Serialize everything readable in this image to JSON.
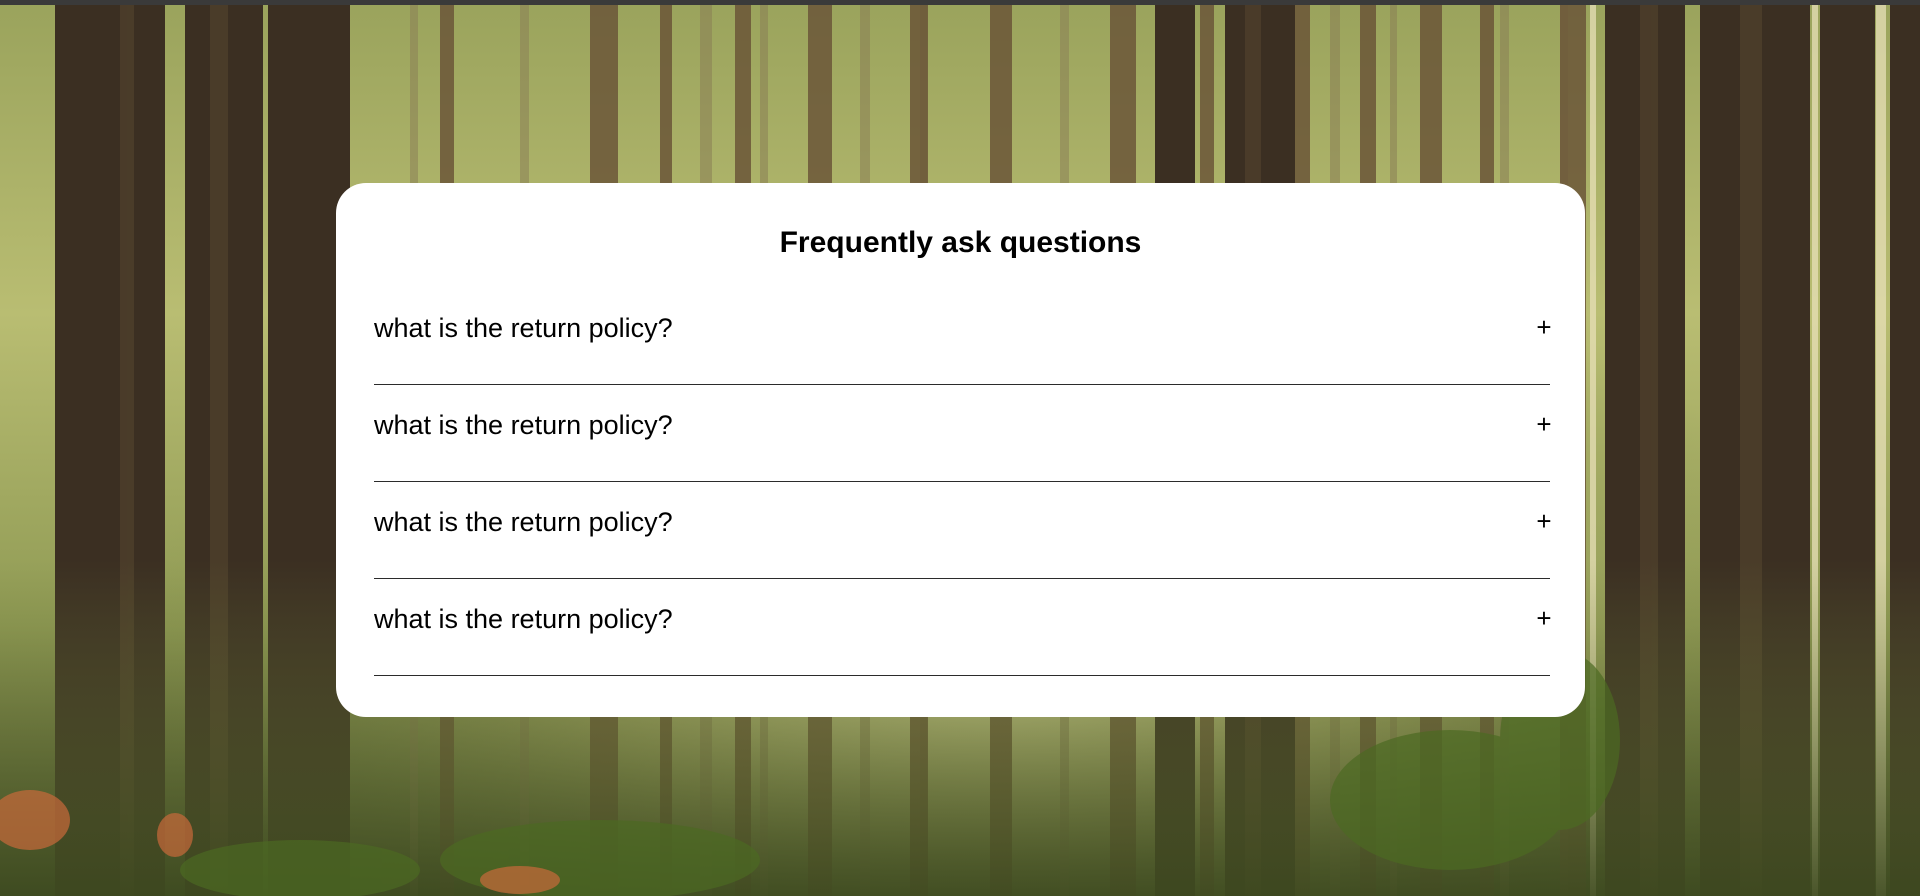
{
  "background": {
    "scene": "sunlit pine forest",
    "colors": {
      "light": "#d9dc8a",
      "mid": "#7f8c4a",
      "dark": "#2d2b1d",
      "trunk": "#4a3a28"
    }
  },
  "faq": {
    "title": "Frequently ask questions",
    "items": [
      {
        "question": "what is the return policy?",
        "toggle": "+",
        "icon": "plus-icon"
      },
      {
        "question": "what is the return policy?",
        "toggle": "+",
        "icon": "plus-icon"
      },
      {
        "question": "what is the return policy?",
        "toggle": "+",
        "icon": "plus-icon"
      },
      {
        "question": "what is the return policy?",
        "toggle": "+",
        "icon": "plus-icon"
      }
    ]
  }
}
